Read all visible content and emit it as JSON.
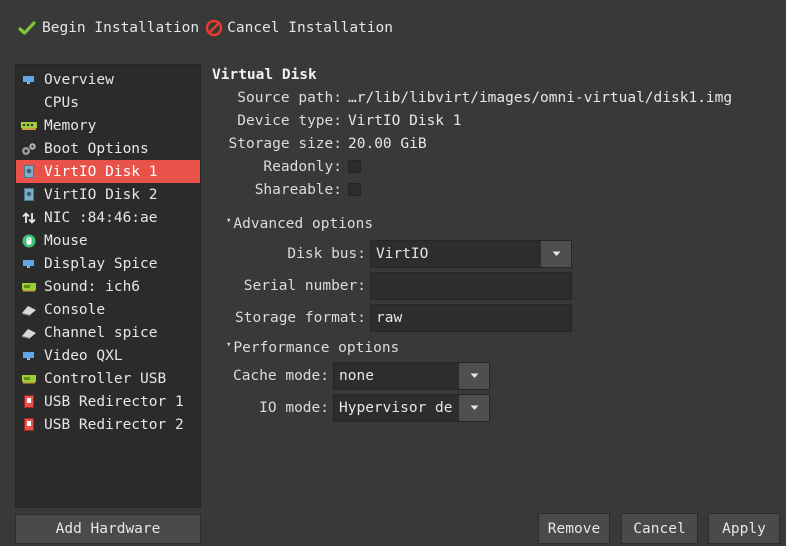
{
  "toolbar": {
    "begin_label": "Begin Installation",
    "cancel_label": "Cancel Installation"
  },
  "sidebar": {
    "items": [
      {
        "label": "Overview",
        "icon": "monitor-icon"
      },
      {
        "label": "CPUs",
        "icon": "cpu-icon"
      },
      {
        "label": "Memory",
        "icon": "memory-icon"
      },
      {
        "label": "Boot Options",
        "icon": "gears-icon"
      },
      {
        "label": "VirtIO Disk 1",
        "icon": "disk-icon",
        "selected": true
      },
      {
        "label": "VirtIO Disk 2",
        "icon": "disk-icon"
      },
      {
        "label": "NIC :84:46:ae",
        "icon": "network-icon"
      },
      {
        "label": "Mouse",
        "icon": "mouse-icon"
      },
      {
        "label": "Display Spice",
        "icon": "display-icon"
      },
      {
        "label": "Sound: ich6",
        "icon": "sound-card-icon"
      },
      {
        "label": "Console",
        "icon": "console-icon"
      },
      {
        "label": "Channel spice",
        "icon": "channel-icon"
      },
      {
        "label": "Video QXL",
        "icon": "video-icon"
      },
      {
        "label": "Controller USB",
        "icon": "controller-icon"
      },
      {
        "label": "USB Redirector 1",
        "icon": "usb-redirector-icon"
      },
      {
        "label": "USB Redirector 2",
        "icon": "usb-redirector-icon"
      }
    ],
    "add_hardware_label": "Add Hardware"
  },
  "main": {
    "section_title": "Virtual Disk",
    "source_path_label": "Source path:",
    "source_path_value": "…r/lib/libvirt/images/omni-virtual/disk1.img",
    "device_type_label": "Device type:",
    "device_type_value": "VirtIO Disk 1",
    "storage_size_label": "Storage size:",
    "storage_size_value": "20.00 GiB",
    "readonly_label": "Readonly:",
    "shareable_label": "Shareable:",
    "advanced_label": "Advanced options",
    "disk_bus_label": "Disk bus:",
    "disk_bus_value": "VirtIO",
    "serial_number_label": "Serial number:",
    "serial_number_value": "",
    "storage_format_label": "Storage format:",
    "storage_format_value": "raw",
    "performance_label": "Performance options",
    "cache_mode_label": "Cache mode:",
    "cache_mode_value": "none",
    "io_mode_label": "IO mode:",
    "io_mode_value": "Hypervisor de"
  },
  "buttons": {
    "remove": "Remove",
    "cancel": "Cancel",
    "apply": "Apply"
  },
  "colors": {
    "background": "#393939",
    "sidebar_bg": "#2b2b2b",
    "selected": "#e9524a",
    "check_green": "#7ec535",
    "cancel_red": "#ef3b2f"
  }
}
